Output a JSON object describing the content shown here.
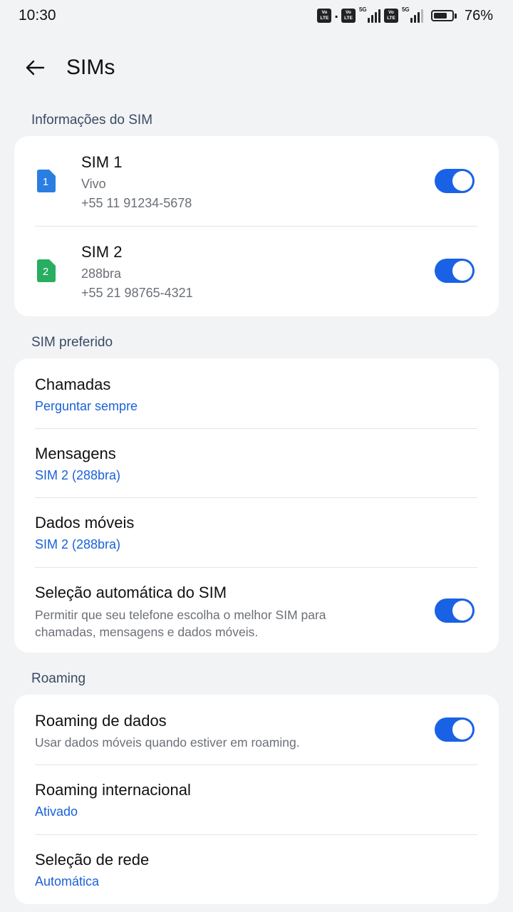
{
  "status_bar": {
    "time": "10:30",
    "battery_percent": "76%",
    "battery_level": 0.76,
    "network_type": "5G",
    "volte_top": "Vo",
    "volte_bottom": "LTE"
  },
  "header": {
    "title": "SIMs"
  },
  "sim_info": {
    "section_label": "Informações do SIM",
    "sims": [
      {
        "title": "SIM 1",
        "badge": "1",
        "carrier": "Vivo",
        "number": "+55 11 91234-5678",
        "enabled": true,
        "color": "#2a7de1"
      },
      {
        "title": "SIM 2",
        "badge": "2",
        "carrier": "288bra",
        "number": "+55 21 98765-4321",
        "enabled": true,
        "color": "#27ae60"
      }
    ]
  },
  "preferred_sim": {
    "section_label": "SIM preferido",
    "calls": {
      "title": "Chamadas",
      "value": "Perguntar sempre"
    },
    "messages": {
      "title": "Mensagens",
      "value": "SIM 2 (288bra)"
    },
    "mobile_data": {
      "title": "Dados móveis",
      "value": "SIM 2 (288bra)"
    },
    "auto_select": {
      "title": "Seleção automática do SIM",
      "description": "Permitir que seu telefone escolha o melhor SIM para chamadas, mensagens e dados móveis.",
      "enabled": true
    }
  },
  "roaming": {
    "section_label": "Roaming",
    "data_roaming": {
      "title": "Roaming de dados",
      "description": "Usar dados móveis quando estiver em roaming.",
      "enabled": true
    },
    "international": {
      "title": "Roaming internacional",
      "value": "Ativado"
    },
    "network_selection": {
      "title": "Seleção de rede",
      "value": "Automática"
    }
  },
  "colors": {
    "accent": "#1a62e5",
    "link": "#1a62d8",
    "background": "#f2f3f5"
  }
}
